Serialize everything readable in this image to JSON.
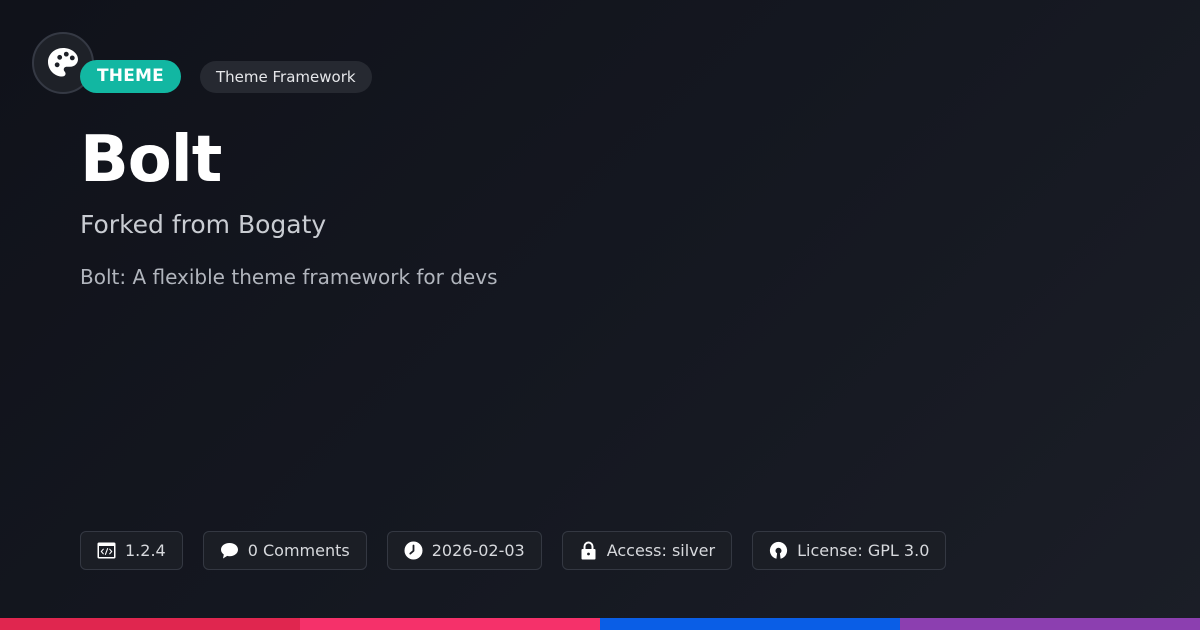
{
  "badge": {
    "icon": "palette-icon",
    "type_label": "THEME",
    "type_color": "#12b7a2",
    "category": "Theme Framework"
  },
  "title": "Bolt",
  "subtitle": "Forked from Bogaty",
  "description": "Bolt: A flexible theme framework for devs",
  "meta": [
    {
      "icon": "code-window-icon",
      "text": "1.2.4"
    },
    {
      "icon": "comment-icon",
      "text": "0 Comments"
    },
    {
      "icon": "clock-icon",
      "text": "2026-02-03"
    },
    {
      "icon": "lock-icon",
      "text": "Access: silver"
    },
    {
      "icon": "open-source-icon",
      "text": "License: GPL 3.0"
    }
  ],
  "accent_stripe": [
    "#e0264f",
    "#f5316a",
    "#0a5ee6",
    "#8c3fb0"
  ]
}
